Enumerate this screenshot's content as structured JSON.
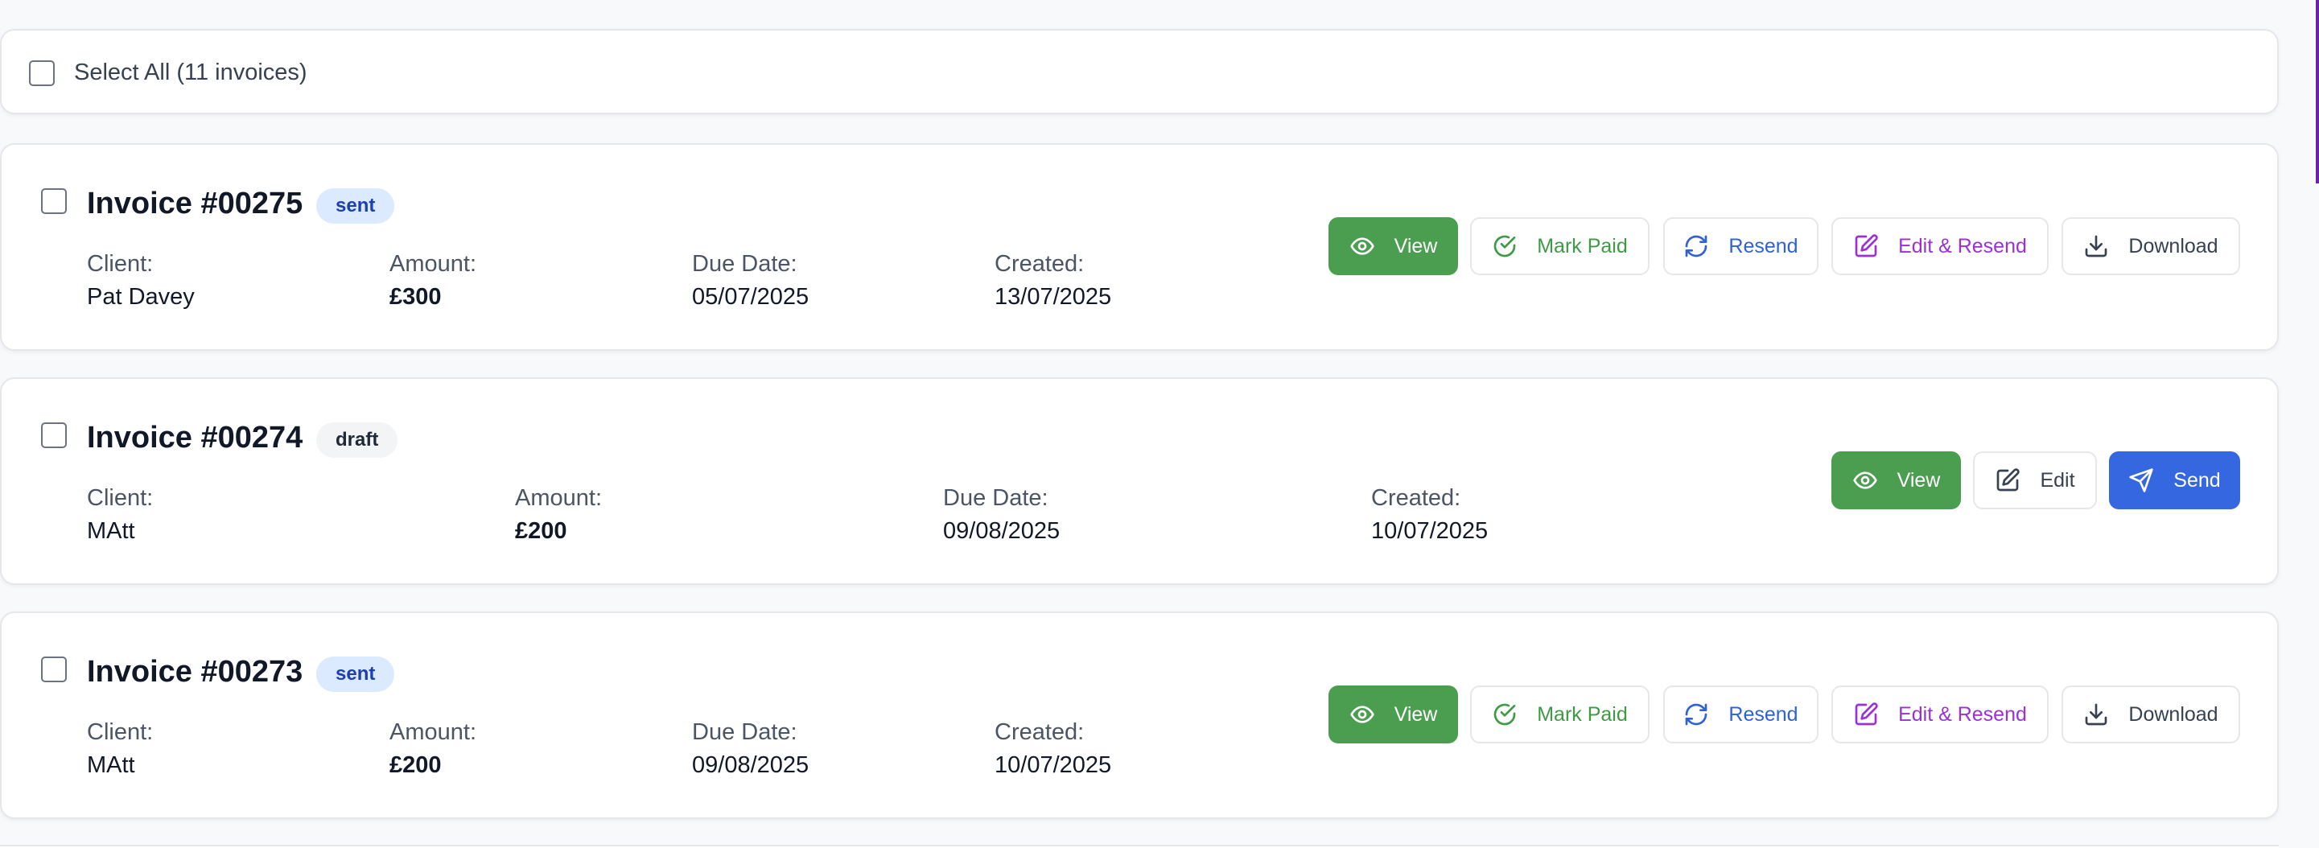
{
  "select_all": {
    "label": "Select All (11 invoices)"
  },
  "field_labels": {
    "client": "Client:",
    "amount": "Amount:",
    "due_date": "Due Date:",
    "created": "Created:"
  },
  "buttons": {
    "view": "View",
    "mark_paid": "Mark Paid",
    "resend": "Resend",
    "edit_resend": "Edit & Resend",
    "download": "Download",
    "edit": "Edit",
    "send": "Send"
  },
  "invoices": [
    {
      "title": "Invoice #00275",
      "status": "sent",
      "client": "Pat Davey",
      "amount": "£300",
      "due_date": "05/07/2025",
      "created": "13/07/2025"
    },
    {
      "title": "Invoice #00274",
      "status": "draft",
      "client": "MAtt",
      "amount": "£200",
      "due_date": "09/08/2025",
      "created": "10/07/2025"
    },
    {
      "title": "Invoice #00273",
      "status": "sent",
      "client": "MAtt",
      "amount": "£200",
      "due_date": "09/08/2025",
      "created": "10/07/2025"
    }
  ],
  "colors": {
    "view_green": "#4b9e4f",
    "mark_paid_green": "#3e9a45",
    "resend_blue": "#2f62d6",
    "edit_resend_purple": "#9b30d6",
    "send_blue": "#3567e0",
    "sent_badge_bg": "#dbeafe",
    "draft_badge_bg": "#f3f4f6"
  }
}
